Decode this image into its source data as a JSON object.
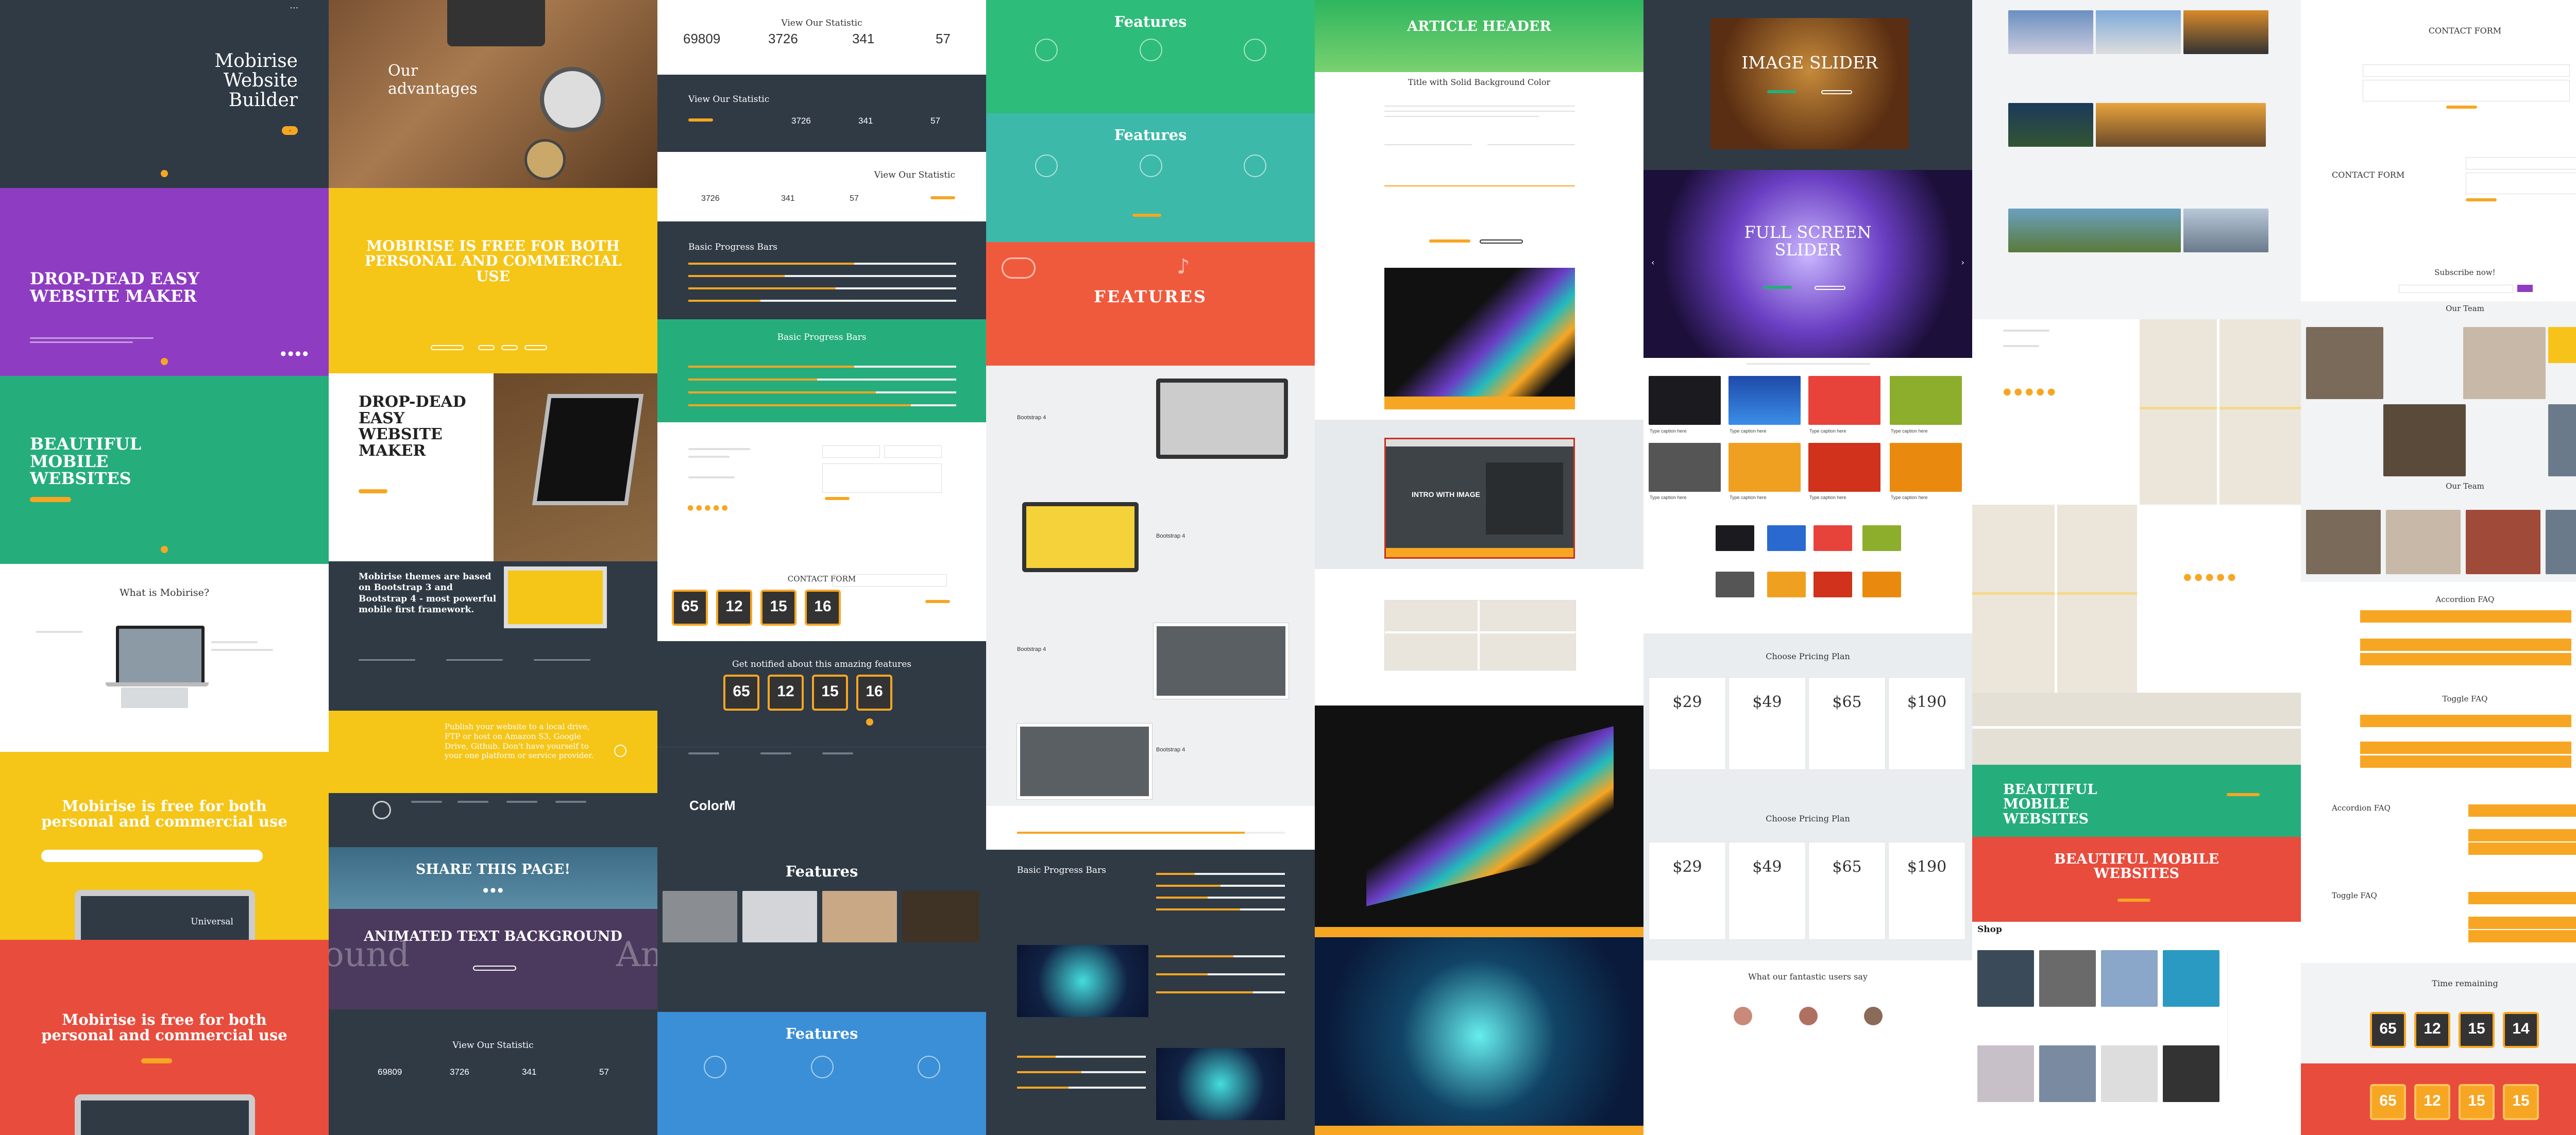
{
  "col1": {
    "hero_title": "Mobirise Website Builder",
    "purple_title": "DROP-DEAD EASY WEBSITE MAKER",
    "green_title": "BEAUTIFUL MOBILE WEBSITES",
    "what_title": "What is Mobirise?",
    "yellow_title": "Mobirise is free for both personal and commercial use",
    "laptop_caption": "Universal",
    "red_title": "Mobirise is free for both personal and commercial use"
  },
  "col2": {
    "advantages_title": "Our advantages",
    "yellow_title": "MOBIRISE IS FREE FOR BOTH PERSONAL AND COMMERCIAL USE",
    "dropdead_title": "DROP-DEAD EASY WEBSITE MAKER",
    "themes_title": "Mobirise themes are based on Bootstrap 3 and Bootstrap 4 - most powerful mobile first framework.",
    "publish_text": "Publish your website to a local drive, FTP or host on Amazon S3, Google Drive, Github. Don't have yourself to your one platform or service provider.",
    "share_title": "SHARE THIS PAGE!",
    "animated_title": "ANIMATED TEXT BACKGROUND",
    "animated_left": "ound",
    "animated_right": "An",
    "statistic_title": "View Our Statistic",
    "stat_values": [
      "69809",
      "3726",
      "341",
      "57"
    ]
  },
  "col3": {
    "statistic_title": "View Our Statistic",
    "stat_values": [
      "69809",
      "3726",
      "341",
      "57"
    ],
    "stat_values_dark": [
      "3726",
      "341",
      "57"
    ],
    "progress_title": "Basic Progress Bars",
    "contact_title": "CONTACT FORM",
    "countdown": [
      "65",
      "12",
      "15",
      "16"
    ],
    "notified_title": "Get notified about this amazing features",
    "brand": "ColorM",
    "features_title": "Features"
  },
  "col4": {
    "features_title": "Features",
    "features_red_title": "FEATURES",
    "bootstrap_label": "Bootstrap 4",
    "progress_title": "Basic Progress Bars"
  },
  "col5": {
    "article_title": "ARTICLE HEADER",
    "article_subtitle": "Title with Solid Background Color",
    "intro_title": "INTRO WITH IMAGE"
  },
  "col6": {
    "slider_title": "IMAGE SLIDER",
    "fullscreen_title": "FULL SCREEN SLIDER",
    "caption": "Type caption here",
    "pricing_title": "Choose Pricing Plan",
    "prices": [
      "29",
      "49",
      "65",
      "190"
    ],
    "testimonials_title": "What our fantastic users say"
  },
  "col7": {
    "green_title": "BEAUTIFUL MOBILE WEBSITES",
    "red_title": "BEAUTIFUL MOBILE WEBSITES",
    "shop_title": "Shop"
  },
  "col8": {
    "contact_title": "CONTACT FORM",
    "subscribe_title": "Subscribe now!",
    "team_title": "Our Team",
    "accordion_title": "Accordion FAQ",
    "toggle_title": "Toggle FAQ",
    "time_title": "Time remaining",
    "countdown": [
      "65",
      "12",
      "15",
      "14"
    ]
  },
  "colors": {
    "dark": "#2f3a45",
    "purple": "#8e3cc2",
    "green": "#26ad7c",
    "yellow": "#f5c518",
    "red": "#e84c3d",
    "accent": "#f7a623",
    "blue": "#3b8fd6"
  }
}
